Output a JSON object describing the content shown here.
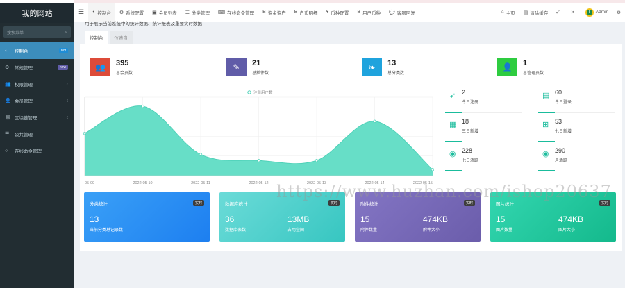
{
  "sidebar": {
    "logo": "我的网站",
    "search_placeholder": "搜索菜单",
    "items": [
      {
        "label": "控制台",
        "icon": "dashboard-icon",
        "badge": "hot",
        "badge_color": "#1f8dd6",
        "active": true
      },
      {
        "label": "常规管理",
        "icon": "cogs-icon",
        "badge": "new",
        "badge_color": "#605ca8"
      },
      {
        "label": "权限管理",
        "icon": "group-icon"
      },
      {
        "label": "会员管理",
        "icon": "user-icon"
      },
      {
        "label": "区块链管理",
        "icon": "chain-icon"
      },
      {
        "label": "公共管理",
        "icon": "list-icon"
      },
      {
        "label": "在线命令管理",
        "icon": "circle-icon"
      }
    ]
  },
  "topbar": {
    "items": [
      {
        "label": "控制台",
        "icon": "dashboard-icon",
        "active": true
      },
      {
        "label": "系统配置",
        "icon": "cogs-icon"
      },
      {
        "label": "会员列表",
        "icon": "id-card-icon"
      },
      {
        "label": "分类管理",
        "icon": "list-icon"
      },
      {
        "label": "在线命令管理",
        "icon": "terminal-icon"
      },
      {
        "label": "资金资产",
        "icon": "bitcoin-icon"
      },
      {
        "label": "户币明细",
        "icon": "bitcoin-icon"
      },
      {
        "label": "币种配置",
        "icon": "rmb-icon"
      },
      {
        "label": "用户币种",
        "icon": "bitcoin-icon"
      },
      {
        "label": "客服回复",
        "icon": "comment-icon"
      }
    ],
    "right": [
      {
        "label": "主页",
        "icon": "home-icon"
      },
      {
        "label": "清除缓存",
        "icon": "trash-icon"
      },
      {
        "label": "",
        "icon": "fullscreen-icon"
      },
      {
        "label": "",
        "icon": "close-icon"
      }
    ],
    "user": "Admin"
  },
  "tip": "用于展示当前系统中的统计数据、统计报表及重要实时数据",
  "tabs": [
    "控制台",
    "仪表盘"
  ],
  "stats": [
    {
      "value": "395",
      "label": "总会员数",
      "color": "#dd4b39",
      "icon": "users-icon"
    },
    {
      "value": "21",
      "label": "总插件数",
      "color": "#605ca8",
      "icon": "magic-icon"
    },
    {
      "value": "13",
      "label": "总分类数",
      "color": "#1fa3dd",
      "icon": "leaf-icon"
    },
    {
      "value": "1",
      "label": "总管理员数",
      "color": "#2ecc40",
      "icon": "user-icon"
    }
  ],
  "minis": [
    {
      "value": "2",
      "label": "今日注册",
      "icon": "rocket-icon"
    },
    {
      "value": "60",
      "label": "今日登录",
      "icon": "vcard-icon"
    },
    {
      "value": "18",
      "label": "三日新增",
      "icon": "calendar-icon"
    },
    {
      "value": "53",
      "label": "七日新增",
      "icon": "calendar-plus-icon"
    },
    {
      "value": "228",
      "label": "七日活跃",
      "icon": "user-circle-icon"
    },
    {
      "value": "290",
      "label": "月活跃",
      "icon": "user-circle-icon"
    }
  ],
  "cards": [
    {
      "title": "分类统计",
      "badge": "实时",
      "bg": "linear-gradient(135deg,#3aa0f7,#1d7ff0)",
      "v1": "13",
      "l1": "当前分类总记录数",
      "v2": "",
      "l2": ""
    },
    {
      "title": "数据库统计",
      "badge": "实时",
      "bg": "linear-gradient(135deg,#6bdbd8,#37c6c1)",
      "v1": "36",
      "l1": "数据库表数",
      "v2": "13MB",
      "l2": "占用空间"
    },
    {
      "title": "附件统计",
      "badge": "实时",
      "bg": "linear-gradient(135deg,#8375c4,#6b5dab)",
      "v1": "15",
      "l1": "附件数量",
      "v2": "474KB",
      "l2": "附件大小"
    },
    {
      "title": "图片统计",
      "badge": "实时",
      "bg": "linear-gradient(135deg,#33d6b0,#14b98c)",
      "v1": "15",
      "l1": "图片数量",
      "v2": "474KB",
      "l2": "图片大小"
    }
  ],
  "watermark": "https://www.huzhan.com/ishop20637",
  "chart_data": {
    "type": "area",
    "legend": "注册用户数",
    "legend_position": "top-center",
    "x": [
      "05-09",
      "2022-05-10",
      "2022-05-11",
      "2022-05-12",
      "2022-05-13",
      "2022-05-14",
      "2022-05-15"
    ],
    "series": [
      {
        "name": "注册用户数",
        "values": [
          14,
          23,
          7,
          5,
          5,
          18,
          2
        ]
      }
    ],
    "ylim": [
      0,
      26
    ],
    "color": "#5fdcc4",
    "grid": true
  }
}
